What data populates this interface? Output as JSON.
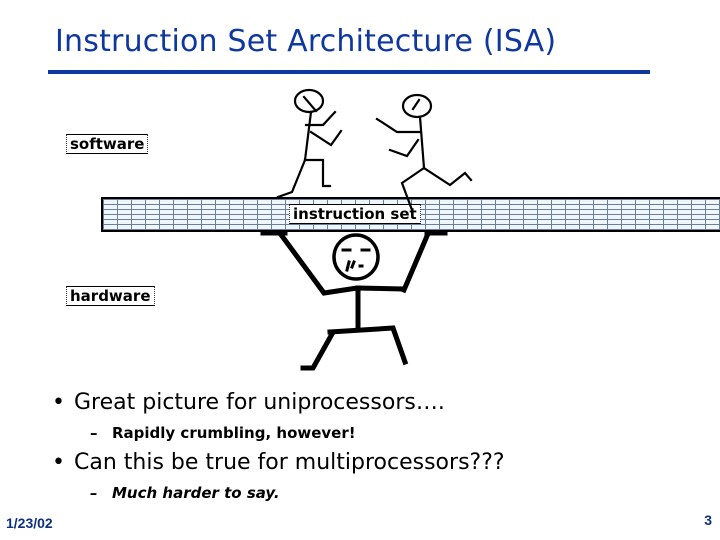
{
  "slide": {
    "title": "Instruction Set Architecture (ISA)",
    "accent_color": "#0f37a0",
    "diagram": {
      "labels": {
        "software": "software",
        "instruction_set": "instruction set",
        "hardware": "hardware"
      }
    },
    "bullets": [
      {
        "text": "Great picture for uniprocessors….",
        "sub": "Rapidly crumbling, however!"
      },
      {
        "text": "Can this be true for multiprocessors???",
        "sub": "Much harder to say."
      }
    ],
    "bullet_glyph": "•",
    "sub_glyph": "–",
    "footer": {
      "date": "1/23/02",
      "page_number": "3"
    }
  }
}
